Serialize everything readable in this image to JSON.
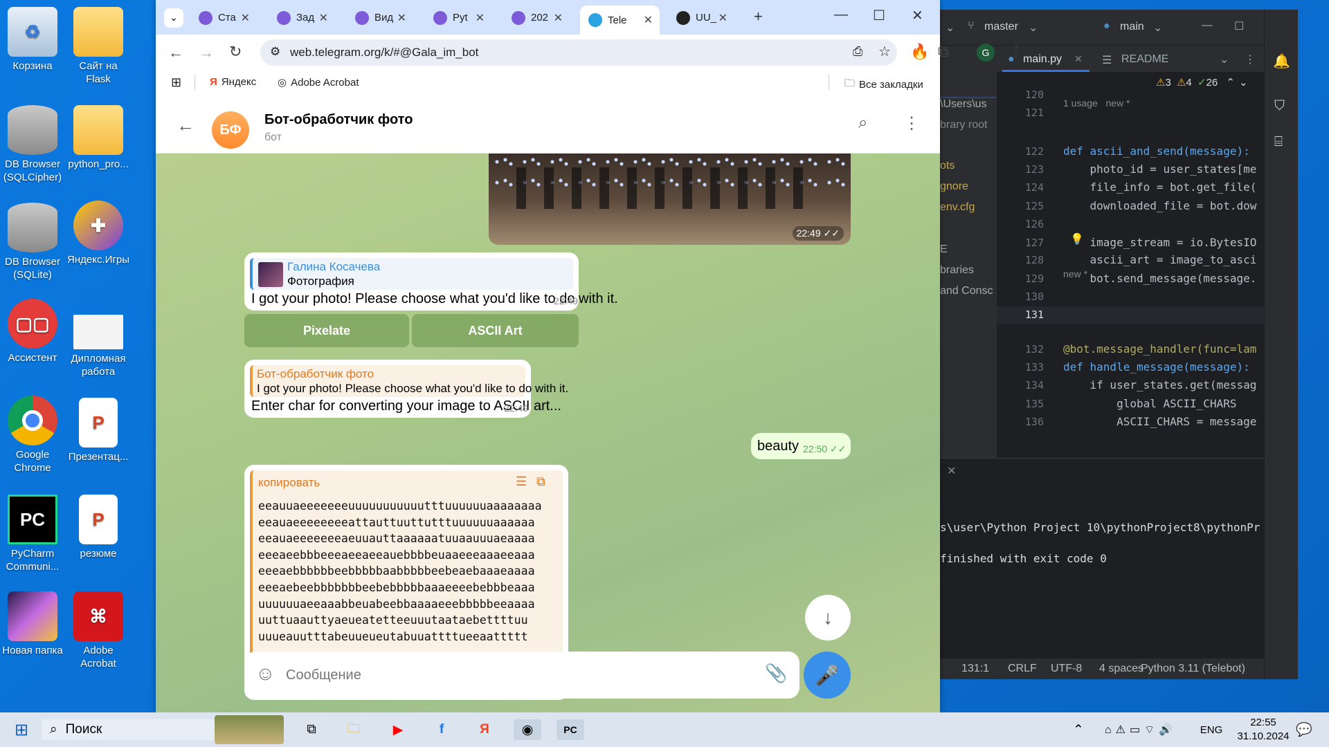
{
  "desktop": {
    "icons": [
      {
        "label": "Корзина",
        "name": "recycle-bin-icon"
      },
      {
        "label": "Сайт на Flask",
        "name": "folder-icon"
      },
      {
        "label": "DB Browser (SQLCipher)",
        "name": "db-browser-icon"
      },
      {
        "label": "python_pro...",
        "name": "folder-icon"
      },
      {
        "label": "DB Browser (SQLite)",
        "name": "db-browser-icon"
      },
      {
        "label": "Яндекс.Игры",
        "name": "gamepad-icon"
      },
      {
        "label": "Ассистент",
        "name": "assistant-icon"
      },
      {
        "label": "Дипломная работа",
        "name": "pptx-file-icon"
      },
      {
        "label": "Google Chrome",
        "name": "chrome-icon"
      },
      {
        "label": "Презентац...",
        "name": "pptx-file-icon"
      },
      {
        "label": "PyCharm Communi...",
        "name": "pycharm-icon"
      },
      {
        "label": "резюме",
        "name": "pptx-file-icon"
      },
      {
        "label": "Новая папка",
        "name": "folder-icon"
      },
      {
        "label": "Adobe Acrobat",
        "name": "acrobat-icon"
      }
    ]
  },
  "browser": {
    "tabs": [
      {
        "label": "Ста"
      },
      {
        "label": "Зад"
      },
      {
        "label": "Вид"
      },
      {
        "label": "Pyt"
      },
      {
        "label": "202"
      },
      {
        "label": "Tele"
      },
      {
        "label": "UU_"
      }
    ],
    "url": "web.telegram.org/k/#@Gala_im_bot",
    "profile_letter": "G",
    "bookmarks": {
      "yandex": "Яндекс",
      "acrobat": "Adobe Acrobat",
      "all": "Все закладки"
    }
  },
  "chat": {
    "title": "Бот-обработчик фото",
    "subtitle": "бот",
    "avatar_initials": "БФ",
    "photo_time": "22:49",
    "msg1": {
      "reply_name": "Галина Косачева",
      "reply_text": "Фотография",
      "text": "I got your photo! Please choose what you'd like to do with it.",
      "time": "22:49"
    },
    "buttons": {
      "pixelate": "Pixelate",
      "ascii": "ASCII Art"
    },
    "msg2": {
      "reply_name": "Бот-обработчик фото",
      "reply_text": "I got your photo! Please choose what you'd like to do with it.",
      "text": "Enter char for converting your image to ASCII art...",
      "time": "22:49"
    },
    "msg3": {
      "text": "beauty",
      "time": "22:50"
    },
    "code": {
      "label": "копировать",
      "lines": [
        "eeauuaeeeeeeeuuuuuuuuuuutttuuuuuuaaaaaaaa",
        "eeauaeeeeeeeeattauttuuttutttuuuuuuaaaaaa",
        "eeauaeeeeeeeaeuuauttaaaaaatuuaauuuaeaaaa",
        "eeeaeebbbeeeaeeaeeauebbbbeuaaeeeaaaeeaaa",
        "eeeaebbbbbbeebbbbbaabbbbbeebeaebaaaeaaaa",
        "eeeaebeebbbbbbbeebebbbbbaaaeeeebebbbeaaa",
        "uuuuuuaeeaaabbeuabeebbaaaaeeebbbbbeeaaaa",
        "uuttuaauttyaeueatetteeuuutaataebettttuu",
        "uuueauutttabeuueueutabuuattttueeaattttt"
      ]
    },
    "composer_placeholder": "Сообщение"
  },
  "pycharm": {
    "branch": "master",
    "run_config": "main",
    "tabs": {
      "file": "main.py",
      "readme": "README"
    },
    "inspections": {
      "warn1": "3",
      "warn2": "4",
      "ok": "26"
    },
    "project": [
      "\\Users\\us",
      "brary root",
      "ots",
      "gnore",
      "env.cfg",
      "E",
      "braries",
      "and Consc"
    ],
    "usage1": "1 usage   new *",
    "usage2": "new *",
    "lines": [
      {
        "n": "120",
        "code": ""
      },
      {
        "n": "121",
        "code": ""
      },
      {
        "n": "122",
        "code": "def ascii_and_send(message):"
      },
      {
        "n": "123",
        "code": "    photo_id = user_states[me"
      },
      {
        "n": "124",
        "code": "    file_info = bot.get_file("
      },
      {
        "n": "125",
        "code": "    downloaded_file = bot.dow"
      },
      {
        "n": "126",
        "code": ""
      },
      {
        "n": "127",
        "code": "    image_stream = io.BytesIO"
      },
      {
        "n": "128",
        "code": "    ascii_art = image_to_asci"
      },
      {
        "n": "129",
        "code": "    bot.send_message(message."
      },
      {
        "n": "130",
        "code": ""
      },
      {
        "n": "131",
        "code": ""
      },
      {
        "n": "132",
        "code": "@bot.message_handler(func=lam"
      },
      {
        "n": "133",
        "code": "def handle_message(message):"
      },
      {
        "n": "134",
        "code": "    if user_states.get(messag"
      },
      {
        "n": "135",
        "code": "        global ASCII_CHARS"
      },
      {
        "n": "136",
        "code": "        ASCII_CHARS = message"
      }
    ],
    "terminal": {
      "path": "s\\user\\Python Project 10\\pythonProject8\\pythonPr",
      "finished": "finished with exit code 0"
    },
    "status": {
      "pos": "131:1",
      "eol": "CRLF",
      "enc": "UTF-8",
      "indent": "4 spaces",
      "interp": "Python 3.11 (Telebot)"
    }
  },
  "taskbar": {
    "search": "Поиск",
    "lang": "ENG",
    "time": "22:55",
    "date": "31.10.2024"
  }
}
